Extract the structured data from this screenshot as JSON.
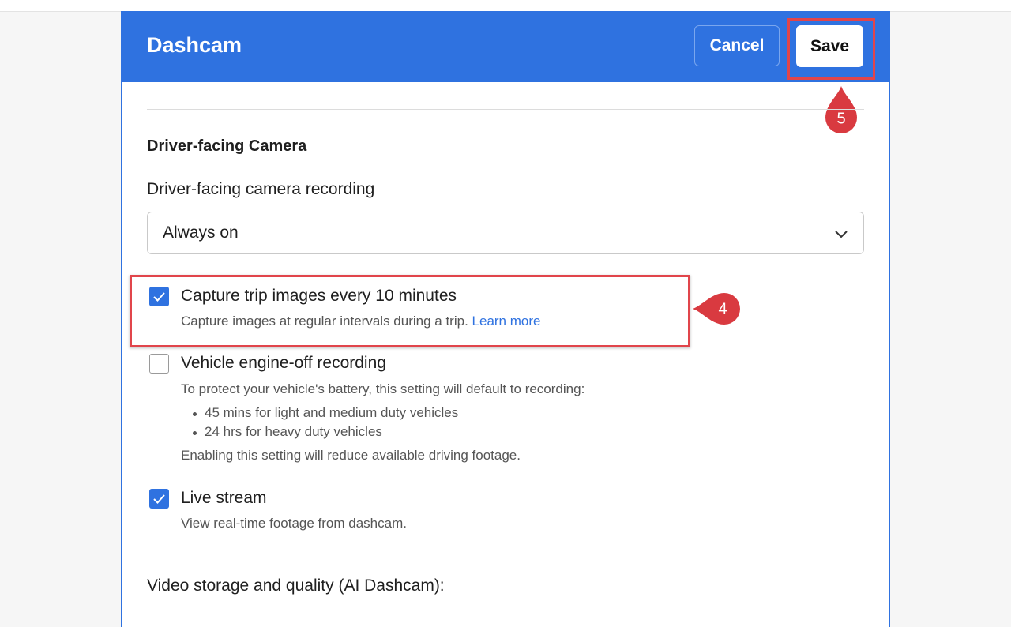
{
  "header": {
    "title": "Dashcam",
    "cancel_label": "Cancel",
    "save_label": "Save"
  },
  "annotations": {
    "save_step": "5",
    "capture_step": "4"
  },
  "section": {
    "title": "Driver-facing Camera",
    "recording_label": "Driver-facing camera recording",
    "recording_value": "Always on"
  },
  "options": {
    "capture": {
      "checked": true,
      "label": "Capture trip images every 10 minutes",
      "desc": "Capture images at regular intervals during a trip.",
      "link": "Learn more"
    },
    "engine_off": {
      "checked": false,
      "label": "Vehicle engine-off recording",
      "desc": "To protect your vehicle's battery, this setting will default to recording:",
      "bullets": [
        "45 mins for light and medium duty vehicles",
        "24 hrs for heavy duty vehicles"
      ],
      "note": "Enabling this setting will reduce available driving footage."
    },
    "live_stream": {
      "checked": true,
      "label": "Live stream",
      "desc": "View real-time footage from dashcam."
    }
  },
  "storage": {
    "title": "Video storage and quality (AI Dashcam):"
  },
  "colors": {
    "accent": "#2f72e0",
    "highlight": "#e1454b",
    "marker": "#d93a40"
  },
  "icons": {
    "check": "check-icon",
    "chevron": "chevron-down-icon"
  }
}
